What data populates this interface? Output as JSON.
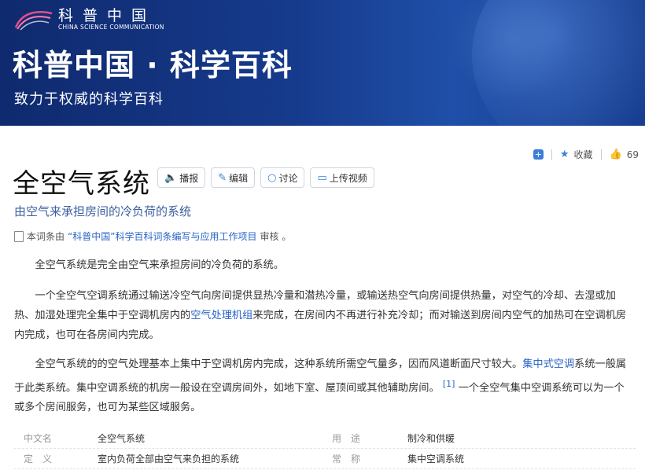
{
  "banner": {
    "logo_cn": "科普中国",
    "logo_en": "CHINA SCIENCE COMMUNICATION",
    "title": "科普中国 · 科学百科",
    "subtitle": "致力于权威的科学百科"
  },
  "actions": {
    "add_icon": "plus-square-icon",
    "collect_label": "收藏",
    "like_count": "69"
  },
  "article": {
    "title": "全空气系统",
    "subtitle": "由空气来承担房间的冷负荷的系统",
    "tools": [
      {
        "icon": "speaker-icon",
        "label": "播报"
      },
      {
        "icon": "edit-icon",
        "label": "编辑"
      },
      {
        "icon": "comment-icon",
        "label": "讨论"
      },
      {
        "icon": "video-icon",
        "label": "上传视频"
      }
    ],
    "review": {
      "prefix": "本词条由",
      "link": "“科普中国”科学百科词条编写与应用工作项目",
      "suffix": "审核 。"
    },
    "p1": "全空气系统是完全由空气来承担房间的冷负荷的系统。",
    "p2_a": "一个全空气空调系统通过输送冷空气向房间提供显热冷量和潜热冷量，或输送热空气向房间提供热量，对空气的冷却、去湿或加热、加湿处理完全集中于空调机房内的",
    "p2_link": "空气处理机组",
    "p2_b": "来完成，在房间内不再进行补充冷却；而对输送到房间内空气的加热可在空调机房内完成，也可在各房间内完成。",
    "p3_a": "全空气系统的的空气处理基本上集中于空调机房内完成，这种系统所需空气量多，因而风道断面尺寸较大。",
    "p3_link": "集中式空调",
    "p3_b": "系统一般属于此类系统。集中空调系统的机房一般设在空调房间外，如地下室、屋顶间或其他辅助房间。",
    "p3_ref": "[1]",
    "p3_c": "一个全空气集中空调系统可以为一个或多个房间服务，也可为某些区域服务。"
  },
  "info": {
    "rows": [
      {
        "k1": "中文名",
        "v1": "全空气系统",
        "k2": "用　途",
        "v2": "制冷和供暖"
      },
      {
        "k1": "定　义",
        "v1": "室内负荷全部由空气来负担的系统",
        "k2": "常　称",
        "v2": "集中空调系统"
      }
    ]
  }
}
